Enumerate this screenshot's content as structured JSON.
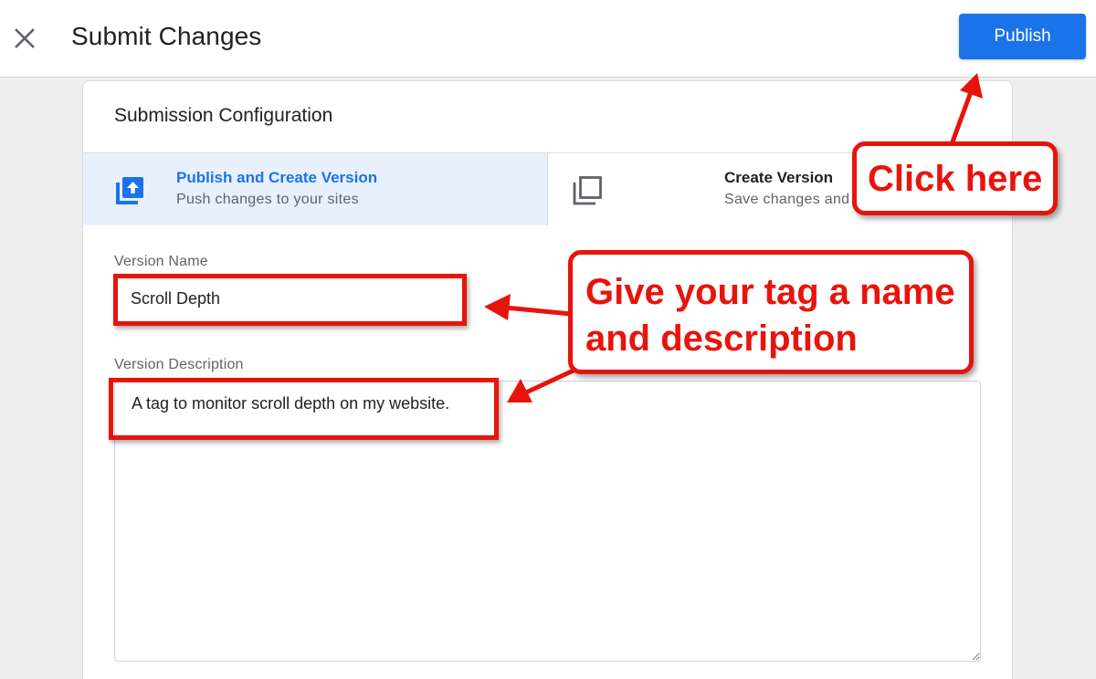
{
  "header": {
    "title": "Submit Changes",
    "publish_label": "Publish"
  },
  "card": {
    "title": "Submission Configuration",
    "options": [
      {
        "title": "Publish and Create Version",
        "subtitle": "Push changes to your sites",
        "selected": true,
        "icon": "publish-upload-icon"
      },
      {
        "title": "Create Version",
        "subtitle": "Save changes and create a ne",
        "selected": false,
        "icon": "copy-version-icon"
      }
    ],
    "version_name": {
      "label": "Version Name",
      "value": "Scroll Depth"
    },
    "version_description": {
      "label": "Version Description",
      "value": "A tag to monitor scroll depth on my website."
    }
  },
  "annotations": {
    "click_here": "Click here",
    "name_description_line1": "Give your tag a name",
    "name_description_line2": "and description"
  },
  "colors": {
    "accent": "#1a73e8",
    "selected_bg": "#e8f0fe",
    "annotation_red": "#e8140c"
  }
}
